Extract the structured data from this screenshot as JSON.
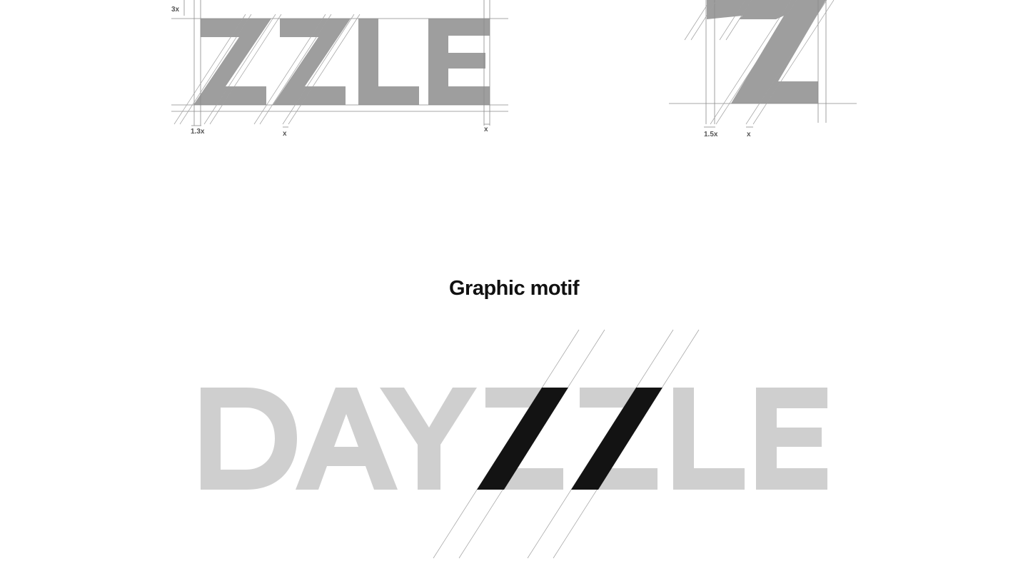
{
  "section": {
    "title": "Graphic motif"
  },
  "construction": {
    "wordmark_detail": {
      "labels": {
        "cap_offset": "3x",
        "stroke_width": "1.3x",
        "gap_z": "x",
        "gap_e": "x"
      }
    },
    "letter_detail": {
      "labels": {
        "stroke_width": "1.5x",
        "gap": "x"
      }
    }
  },
  "motif": {
    "wordmark": "DAYZZLE",
    "highlighted_strokes": 2
  },
  "colors": {
    "background": "#ffffff",
    "title": "#111111",
    "construction_fill": "#9e9e9e",
    "wordmark_fill": "#cfcfcf",
    "accent": "#131313",
    "guides": "#8a8a8a",
    "label": "#555555"
  }
}
